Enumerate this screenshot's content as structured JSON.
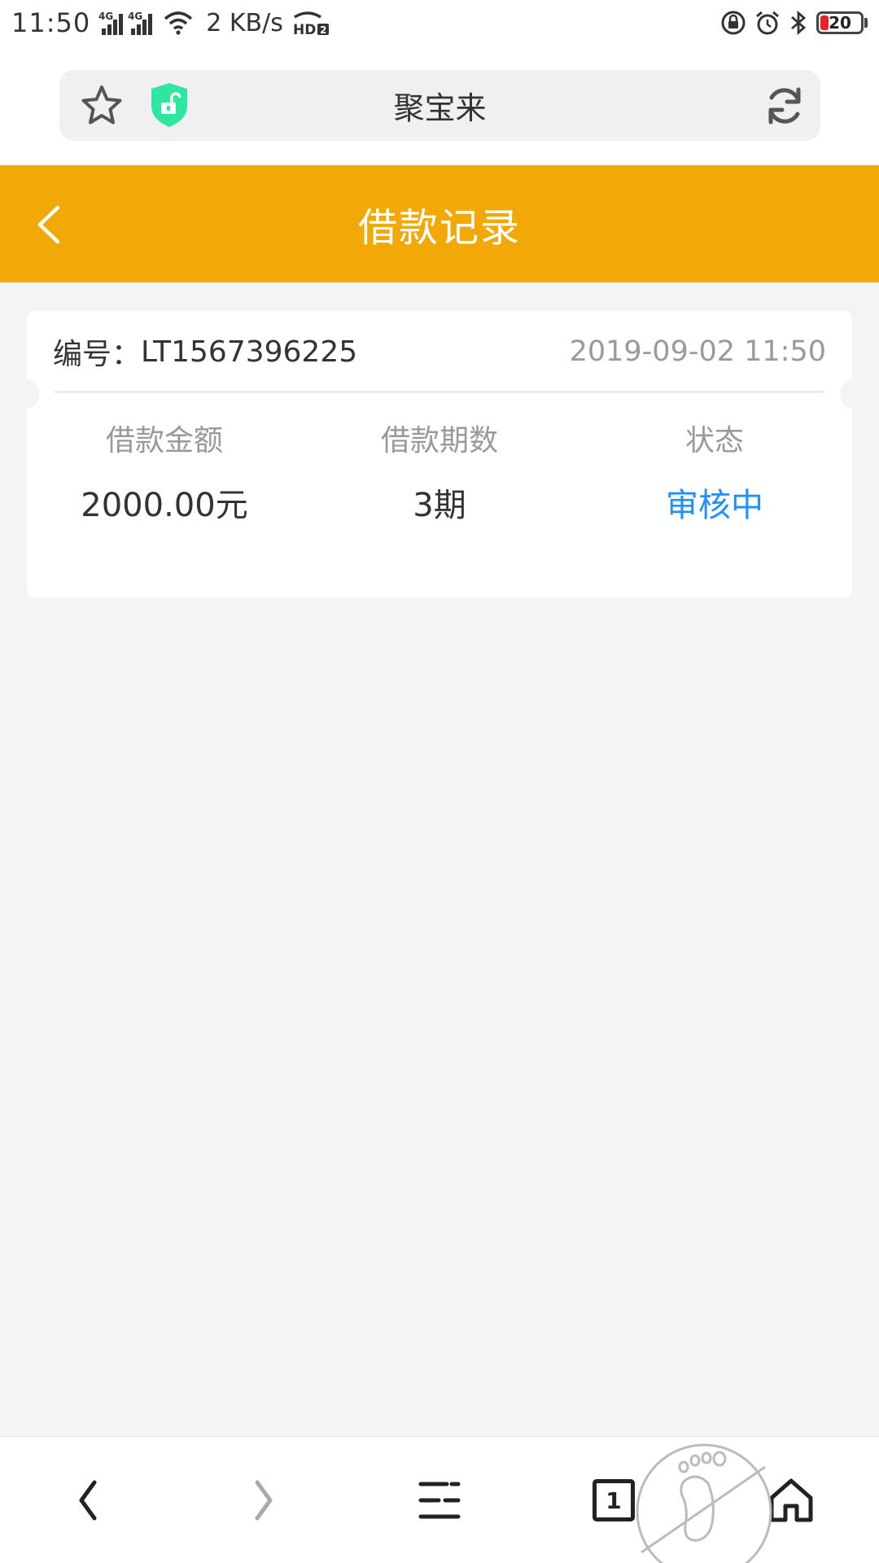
{
  "status_bar": {
    "time": "11:50",
    "network_1": "4G",
    "network_2": "4G",
    "speed": "2 KB/s",
    "hd_badge": "HD",
    "battery_level": "20",
    "battery_fraction": 0.2,
    "icons": [
      "signal-icon",
      "wifi-icon",
      "hd-call-icon",
      "lock-rotation-icon",
      "alarm-icon",
      "bluetooth-icon",
      "battery-icon"
    ]
  },
  "browser": {
    "page_title": "聚宝来",
    "icons": [
      "star-icon",
      "shield-unlock-icon",
      "refresh-icon"
    ]
  },
  "header": {
    "title": "借款记录"
  },
  "record": {
    "id_label": "编号：",
    "id_value": "LT1567396225",
    "datetime": "2019-09-02 11:50",
    "stats": [
      {
        "label": "借款金额",
        "value": "2000.00元"
      },
      {
        "label": "借款期数",
        "value": "3期"
      },
      {
        "label": "状态",
        "value": "审核中"
      }
    ]
  },
  "bottom_nav": {
    "tab_count": "1",
    "icons": [
      "back-icon",
      "forward-icon",
      "menu-icon",
      "tabs-icon",
      "home-icon",
      "no-footprint-icon"
    ]
  },
  "colors": {
    "header_bg": "#f2a807",
    "status_blue": "#1e90ff",
    "page_bg": "#f3f4f6",
    "shield_green": "#2ee6a0",
    "battery_red": "#e8212b"
  }
}
